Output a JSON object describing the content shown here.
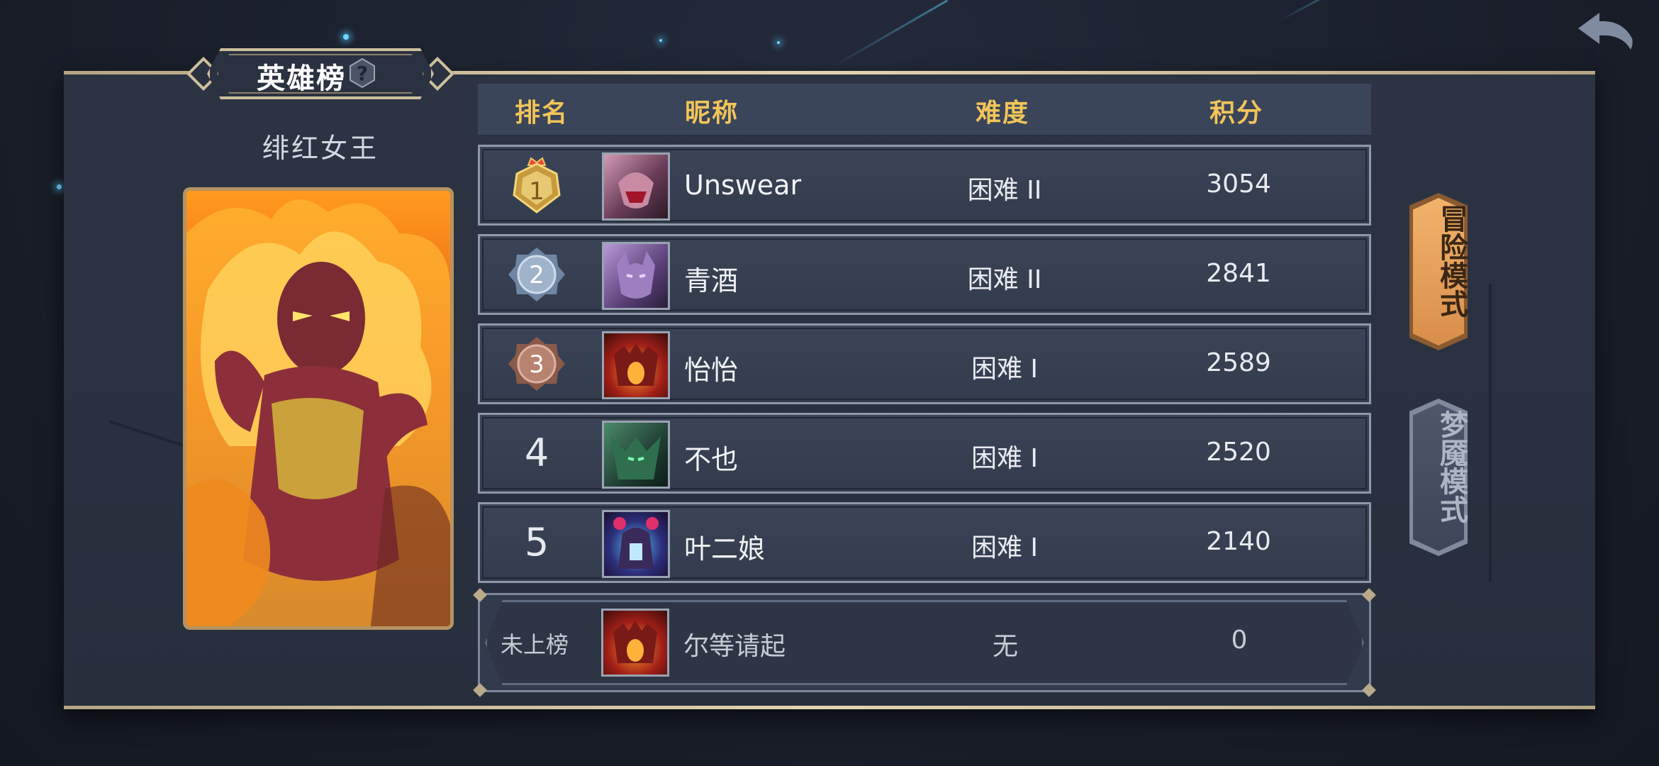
{
  "leaderboard": {
    "title": "英雄榜",
    "hero_name": "绯红女王",
    "headers": {
      "rank": "排名",
      "nickname": "昵称",
      "difficulty": "难度",
      "score": "积分"
    },
    "rows": [
      {
        "rank": "1",
        "nickname": "Unswear",
        "difficulty": "困难 II",
        "score": "3054",
        "badge": "gold-crown"
      },
      {
        "rank": "2",
        "nickname": "青酒",
        "difficulty": "困难 II",
        "score": "2841",
        "badge": "silver"
      },
      {
        "rank": "3",
        "nickname": "怡怡",
        "difficulty": "困难 I",
        "score": "2589",
        "badge": "bronze"
      },
      {
        "rank": "4",
        "nickname": "不也",
        "difficulty": "困难 I",
        "score": "2520"
      },
      {
        "rank": "5",
        "nickname": "叶二娘",
        "difficulty": "困难 I",
        "score": "2140"
      }
    ],
    "self": {
      "rank": "未上榜",
      "nickname": "尔等请起",
      "difficulty": "无",
      "score": "0"
    }
  },
  "modes": [
    {
      "label": "冒险模式",
      "active": true
    },
    {
      "label": "梦魇模式",
      "active": false
    }
  ],
  "icons": {
    "back": "back-arrow-icon",
    "help": "question-icon"
  },
  "colors": {
    "gold": "#f2c559",
    "panel": "#2c3444",
    "active_mode": "#e3a460",
    "inactive_mode": "#4a5568"
  }
}
